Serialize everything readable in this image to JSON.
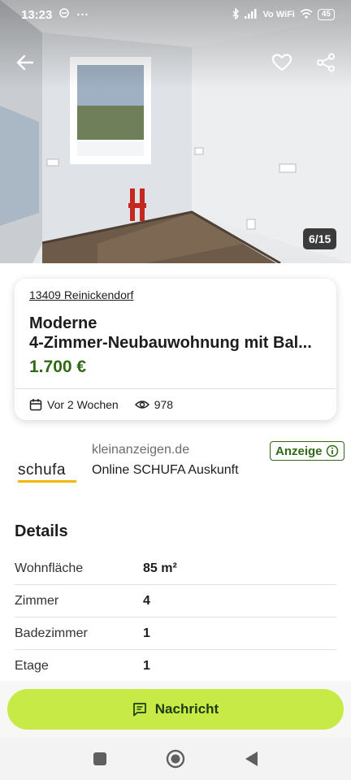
{
  "status_bar": {
    "time": "13:23",
    "more": "···",
    "network": "Vo WiFi",
    "battery": "45"
  },
  "gallery": {
    "counter": "6/15"
  },
  "listing": {
    "location": "13409 Reinickendorf",
    "title_line1": "Moderne",
    "title_line2": "4-Zimmer-Neubauwohnung mit Bal...",
    "price": "1.700 €",
    "posted": "Vor 2 Wochen",
    "views": "978"
  },
  "ad": {
    "logo_text": "schufa",
    "domain": "kleinanzeigen.de",
    "title": "Online SCHUFA Auskunft",
    "badge": "Anzeige"
  },
  "details": {
    "heading": "Details",
    "rows": [
      {
        "label": "Wohnfläche",
        "value": "85 m²"
      },
      {
        "label": "Zimmer",
        "value": "4"
      },
      {
        "label": "Badezimmer",
        "value": "1"
      },
      {
        "label": "Etage",
        "value": "1"
      }
    ]
  },
  "actions": {
    "message_label": "Nachricht"
  },
  "colors": {
    "accent_green": "#326916",
    "button_lime": "#c7ea46"
  }
}
